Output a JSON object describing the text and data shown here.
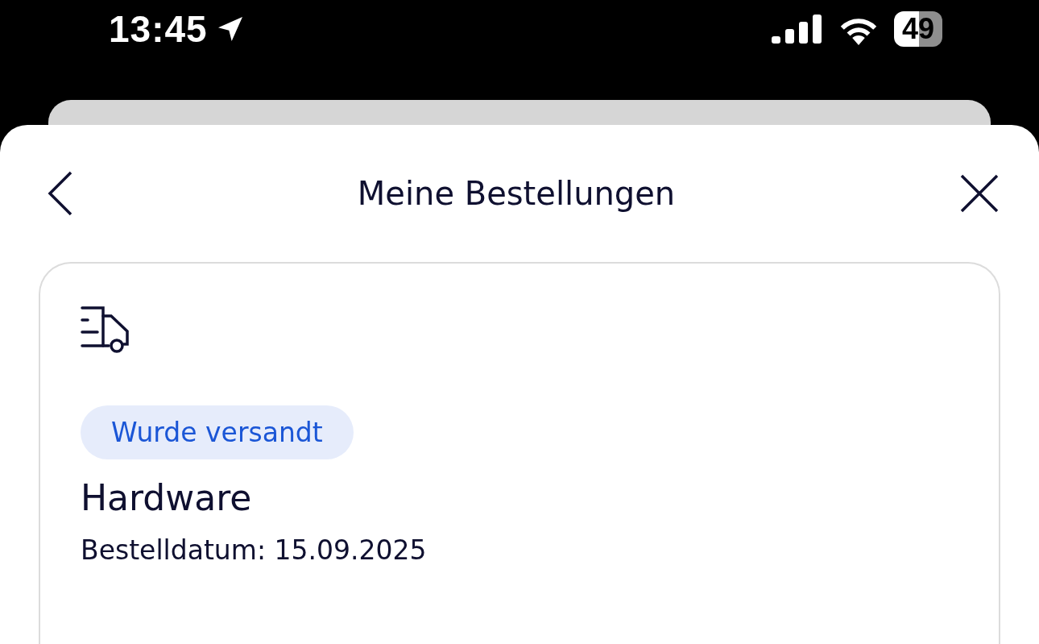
{
  "status_bar": {
    "time": "13:45",
    "battery": "49"
  },
  "header": {
    "title": "Meine Bestellungen"
  },
  "orders": [
    {
      "status": "Wurde versandt",
      "title": "Hardware",
      "order_date": "Bestelldatum: 15.09.2025"
    }
  ]
}
